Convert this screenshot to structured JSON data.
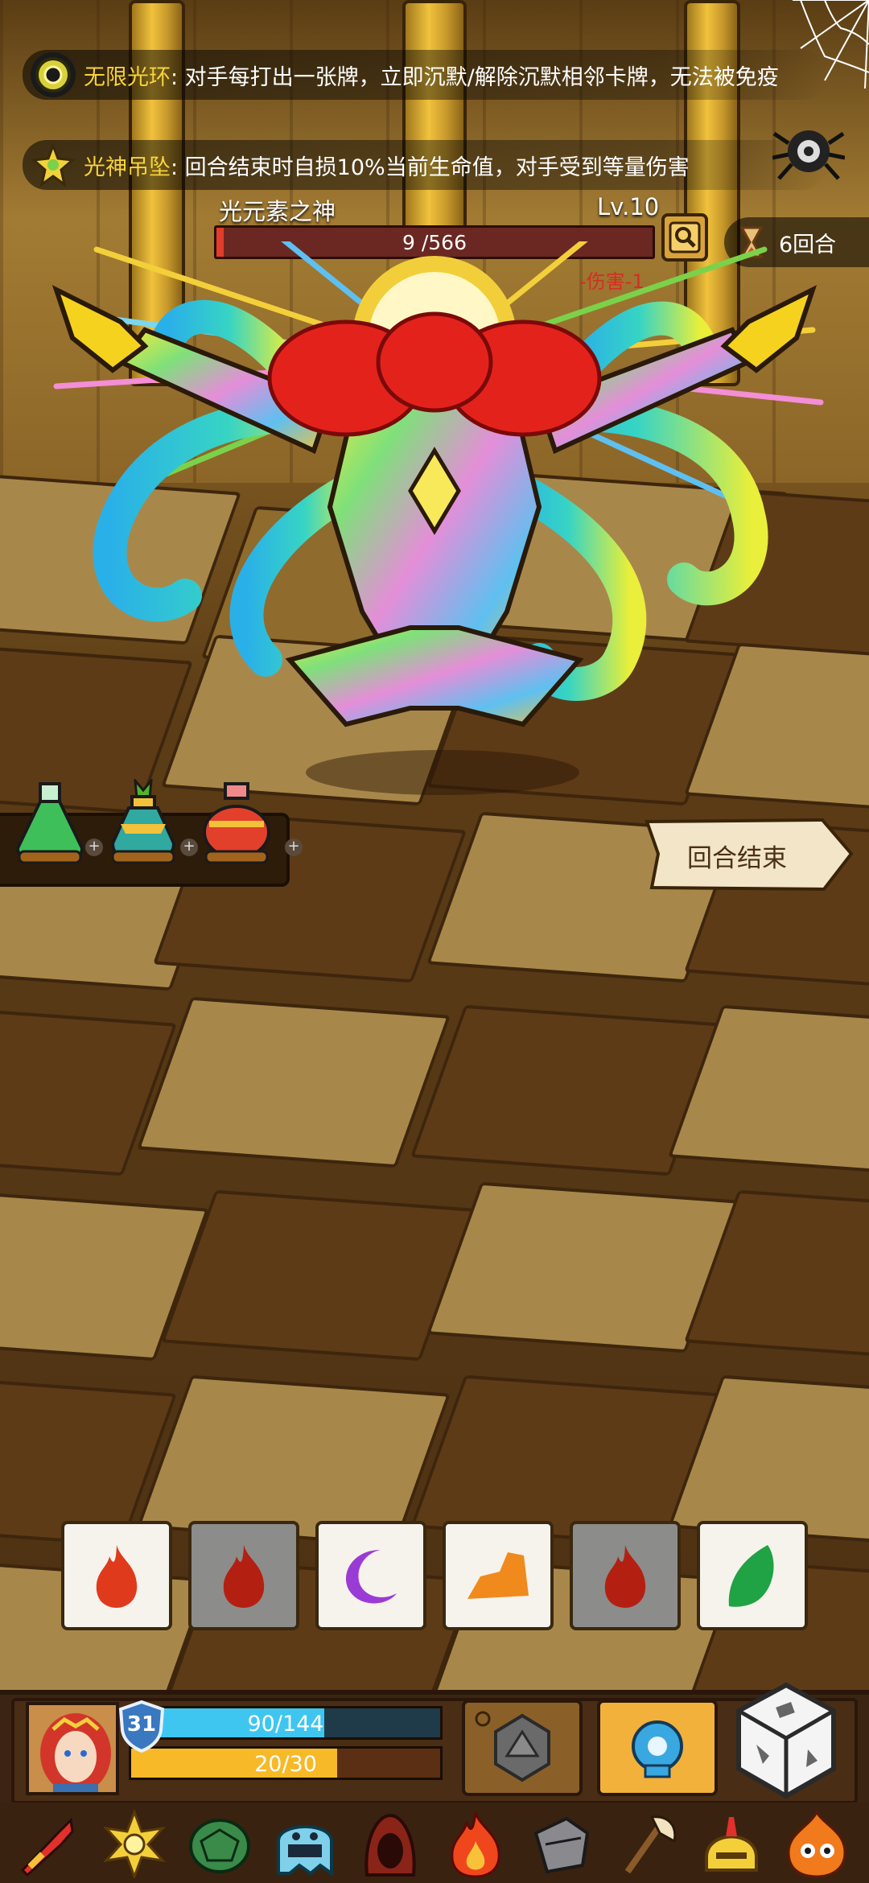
{
  "buffs": [
    {
      "name": "无限光环",
      "desc": ": 对手每打出一张牌，立即沉默/解除沉默相邻卡牌，无法被免疫",
      "icon": "ring-icon"
    },
    {
      "name": "光神吊坠",
      "desc": ": 回合结束时自损10%当前生命值，对手受到等量伤害",
      "icon": "pendant-icon"
    }
  ],
  "boss": {
    "name": "光元素之神",
    "level": "Lv.10",
    "hp_current": 9,
    "hp_max": 566,
    "hp_text": "9 /566",
    "floating_damage": "-伤害-1"
  },
  "round": {
    "label": "6回合"
  },
  "end_turn": {
    "label": "回合结束"
  },
  "potions": [
    {
      "name": "green-potion",
      "color": "#3fbf5a"
    },
    {
      "name": "teal-potion",
      "color": "#31a8a0"
    },
    {
      "name": "red-potion",
      "color": "#e2402a"
    }
  ],
  "dice_cards": [
    {
      "symbol": "flame-icon",
      "color": "#e03a1c",
      "state": "active"
    },
    {
      "symbol": "flame-icon",
      "color": "#b32012",
      "state": "used"
    },
    {
      "symbol": "crescent-icon",
      "color": "#9a3bd6",
      "state": "active"
    },
    {
      "symbol": "rock-icon",
      "color": "#f08a1c",
      "state": "active"
    },
    {
      "symbol": "flame-icon",
      "color": "#b32012",
      "state": "used"
    },
    {
      "symbol": "leaf-icon",
      "color": "#1fa344",
      "state": "active"
    }
  ],
  "player": {
    "shield": "31",
    "hp_current": 90,
    "hp_max": 144,
    "hp_text": "90/144",
    "energy_current": 20,
    "energy_max": 30,
    "energy_text": "20/30"
  },
  "items": [
    "sword-icon",
    "sun-medal-icon",
    "turtle-shell-icon",
    "ghost-slime-icon",
    "hood-icon",
    "fire-icon",
    "gauntlet-icon",
    "axe-icon",
    "helmet-icon",
    "fire-eyes-icon"
  ],
  "colors": {
    "gold": "#f7d43a",
    "hp_red": "#e23d2a",
    "player_hp": "#3ec6f0",
    "energy": "#f7b928"
  }
}
